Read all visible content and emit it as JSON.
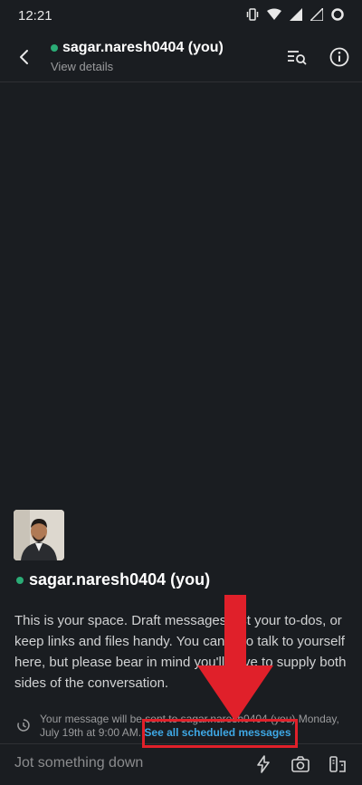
{
  "status_bar": {
    "time": "12:21",
    "icons": [
      "vibrate-icon",
      "wifi-icon",
      "signal-icon",
      "signal-icon",
      "circle-icon"
    ]
  },
  "header": {
    "title": "sagar.naresh0404 (you)",
    "subtitle": "View details",
    "icons": [
      "back-arrow-icon",
      "search-messages-icon",
      "info-icon"
    ]
  },
  "profile": {
    "name": "sagar.naresh0404 (you)"
  },
  "intro_text": "This is your space. Draft messages, list your to-dos, or keep links and files handy. You can also talk to yourself here, but please bear in mind you'll have to supply both sides of the conversation.",
  "scheduled": {
    "text": "Your message will be sent to sagar.naresh0404 (you) Monday, July 19th at 9:00 AM.",
    "link_label": "See all scheduled messages"
  },
  "composer": {
    "placeholder": "Jot something down",
    "icons": [
      "lightning-icon",
      "camera-icon",
      "attachment-icon"
    ]
  },
  "colors": {
    "background": "#1a1d21",
    "presence": "#2bac76",
    "link": "#3ea8e5",
    "annotation": "#e0202a"
  }
}
